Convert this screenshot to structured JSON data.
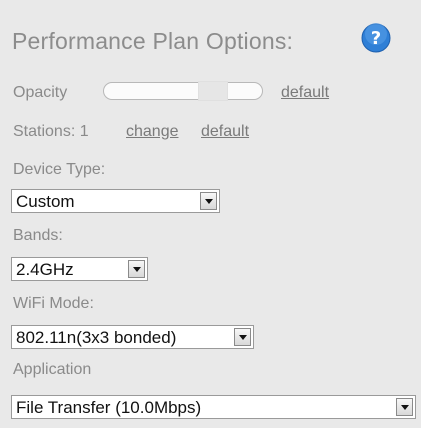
{
  "panel": {
    "title": "Performance Plan Options:",
    "help_icon": "help-question-icon"
  },
  "opacity": {
    "label": "Opacity",
    "default_link": "default"
  },
  "stations": {
    "label": "Stations: 1",
    "change_link": "change",
    "default_link": "default"
  },
  "device_type": {
    "label": "Device Type:",
    "value": "Custom"
  },
  "bands": {
    "label": "Bands:",
    "value": "2.4GHz"
  },
  "wifi_mode": {
    "label": "WiFi Mode:",
    "value": "802.11n(3x3 bonded)"
  },
  "application": {
    "label": "Application",
    "value": "File Transfer (10.0Mbps)"
  },
  "colors": {
    "background": "#e9e9e9",
    "help_icon": "#2f7fd6"
  }
}
